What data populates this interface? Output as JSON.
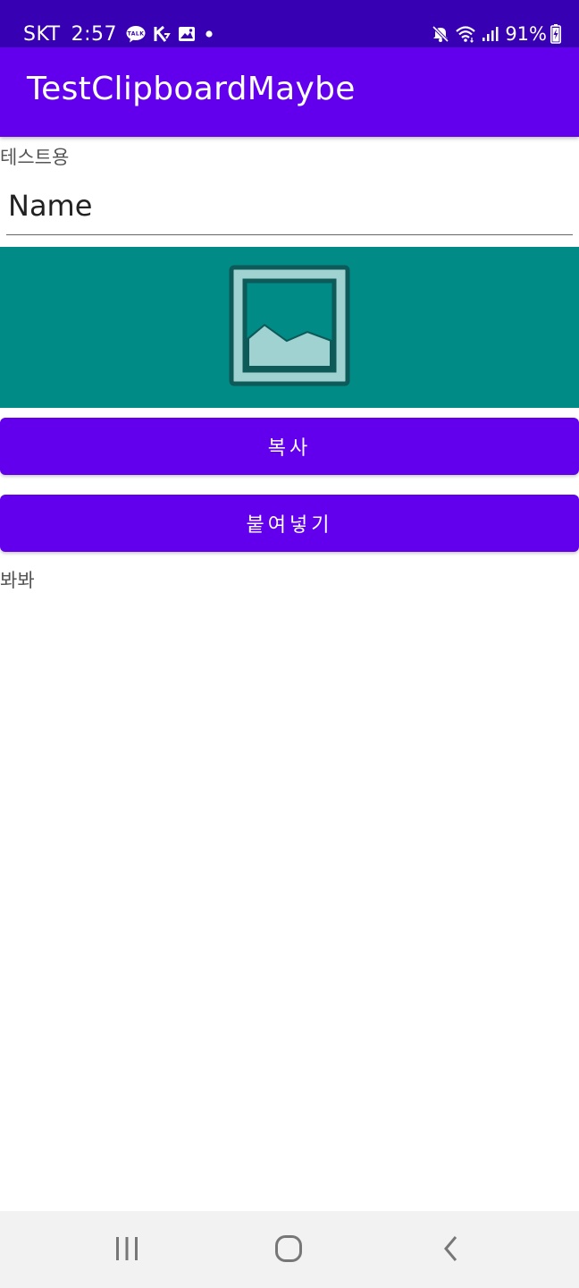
{
  "status_bar": {
    "carrier": "SKT",
    "time": "2:57",
    "talk_badge": "TALK",
    "battery": "91%",
    "icons": [
      "talk-message-icon",
      "k-app-icon",
      "gallery-icon",
      "dot-icon",
      "mute-icon",
      "wifi-icon",
      "signal-icon",
      "battery-charging-icon"
    ]
  },
  "app_bar": {
    "title": "TestClipboardMaybe"
  },
  "main": {
    "test_label": "테스트용",
    "name_field": {
      "placeholder": "Name",
      "value": ""
    },
    "image": {
      "icon": "image-placeholder-icon",
      "background": "#008b87"
    },
    "copy_button": "복사",
    "paste_button": "붙여넣기",
    "result_label": "봐봐"
  },
  "nav_bar": {
    "icons": [
      "recents-icon",
      "home-icon",
      "back-icon"
    ]
  },
  "colors": {
    "status_bar": "#3700b3",
    "primary": "#6200ee",
    "image_bg": "#008b87",
    "nav_bar": "#f2f2f2"
  }
}
